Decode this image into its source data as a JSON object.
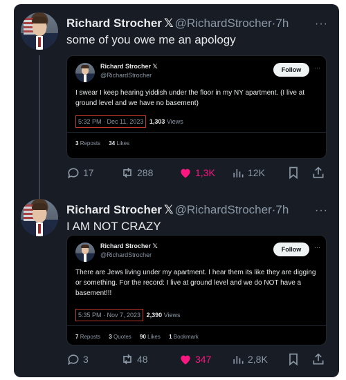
{
  "colors": {
    "background": "#181c25",
    "quote_bg": "#000000",
    "muted": "#8b98a5",
    "text": "#e7e9ea",
    "like": "#f91880",
    "highlight_box": "#c0362c"
  },
  "tweets": [
    {
      "name": "Richard Strocher",
      "x_mark": "𝕏",
      "handle": "@RichardStrocher",
      "dot": "·",
      "time": "7h",
      "more": "···",
      "text": "some of you owe me an apology",
      "quote": {
        "name": "Richard Strocher",
        "x_mark": "𝕏",
        "handle": "@RichardStrocher",
        "follow": "Follow",
        "more": "···",
        "text": "I swear I keep hearing yiddish under the floor in my NY apartment. (I live at ground level and we have no basement)",
        "timestamp": "5:32 PM · Dec 11, 2023",
        "views_num": "1,303",
        "views_label": "Views",
        "reposts_num": "3",
        "reposts_label": "Reposts",
        "likes_num": "34",
        "likes_label": "Likes"
      },
      "actions": {
        "replies": "17",
        "reposts": "288",
        "likes": "1,3K",
        "views": "12K"
      }
    },
    {
      "name": "Richard Strocher",
      "x_mark": "𝕏",
      "handle": "@RichardStrocher",
      "dot": "·",
      "time": "7h",
      "more": "···",
      "text": "I AM NOT CRAZY",
      "quote": {
        "name": "Richard Strocher",
        "x_mark": "𝕏",
        "handle": "@RichardStrocher",
        "follow": "Follow",
        "more": "···",
        "text": "There are Jews living under my apartment. I hear them its like they are digging or something. For the record: I live at ground level and we do NOT have a basement!!!",
        "timestamp": "5:35 PM · Nov 7, 2023",
        "views_num": "2,390",
        "views_label": "Views",
        "reposts_num": "7",
        "reposts_label": "Reposts",
        "quotes_num": "3",
        "quotes_label": "Quotes",
        "likes_num": "90",
        "likes_label": "Likes",
        "bookmarks_num": "1",
        "bookmarks_label": "Bookmark"
      },
      "actions": {
        "replies": "3",
        "reposts": "48",
        "likes": "347",
        "views": "2,8K"
      }
    }
  ]
}
